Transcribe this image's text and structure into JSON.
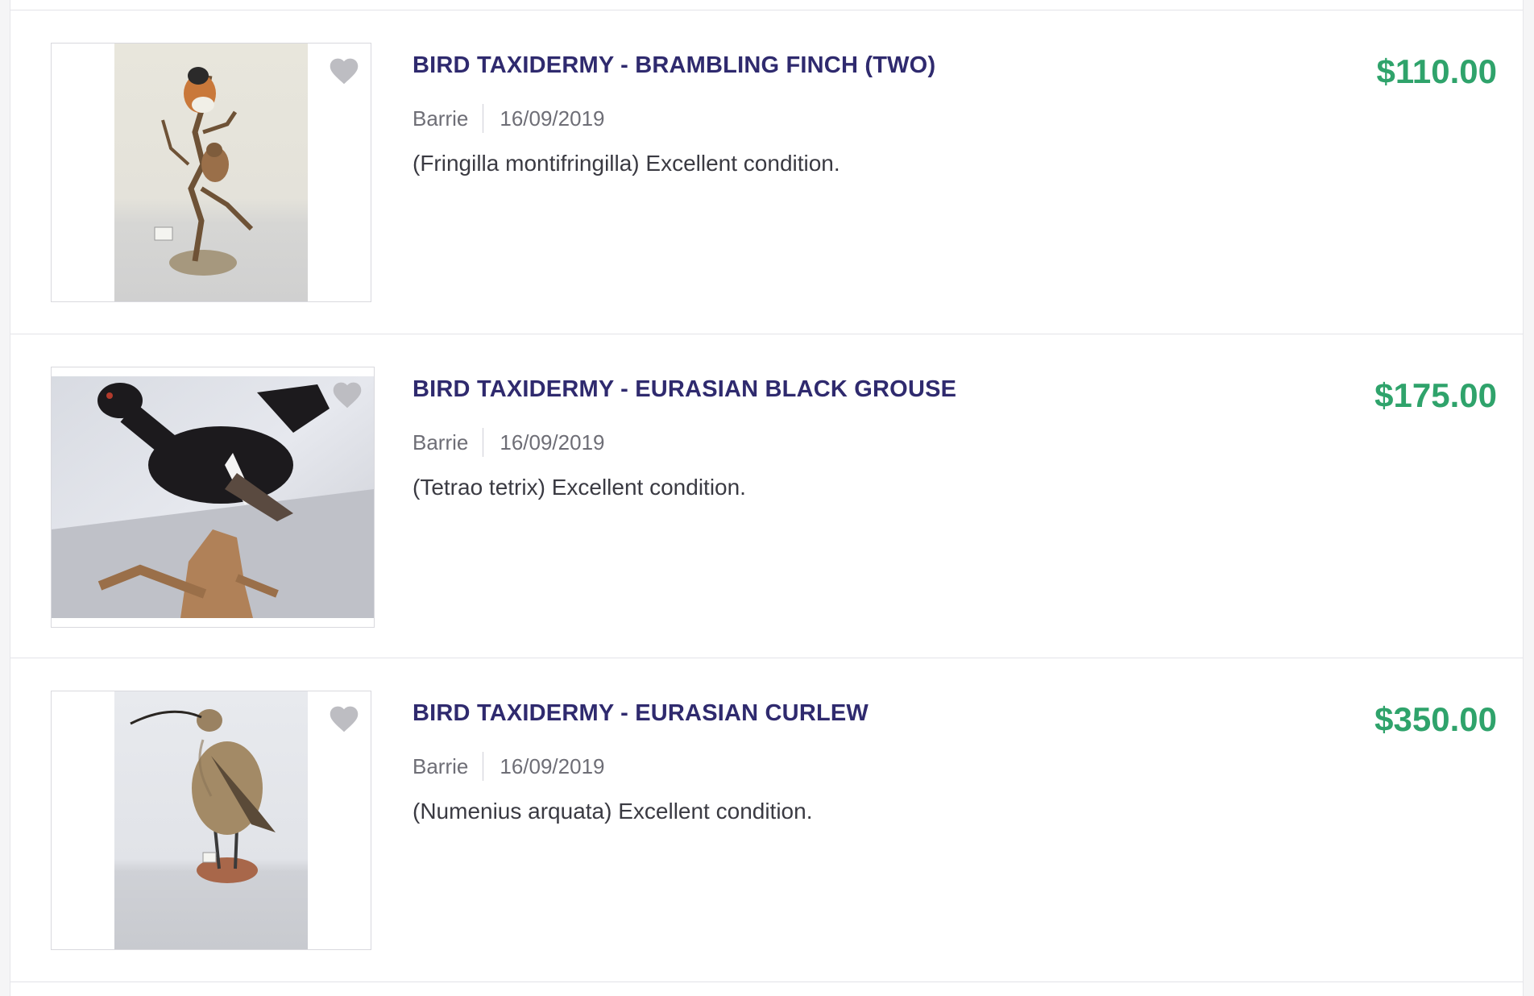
{
  "listings": [
    {
      "title": "BIRD TAXIDERMY - BRAMBLING FINCH (TWO)",
      "location": "Barrie",
      "date": "16/09/2019",
      "description": "(Fringilla montifringilla) Excellent condition.",
      "price": "$110.00",
      "image_icon": "brambling-finch-photo"
    },
    {
      "title": "BIRD TAXIDERMY - EURASIAN BLACK GROUSE",
      "location": "Barrie",
      "date": "16/09/2019",
      "description": "(Tetrao tetrix) Excellent condition.",
      "price": "$175.00",
      "image_icon": "black-grouse-photo"
    },
    {
      "title": "BIRD TAXIDERMY - EURASIAN CURLEW",
      "location": "Barrie",
      "date": "16/09/2019",
      "description": "(Numenius arquata) Excellent condition.",
      "price": "$350.00",
      "image_icon": "eurasian-curlew-photo"
    }
  ],
  "colors": {
    "title": "#2f2a6e",
    "price": "#2fa36b",
    "favorite_icon": "#bdbdc2"
  },
  "favorite_icon": "heart-icon"
}
